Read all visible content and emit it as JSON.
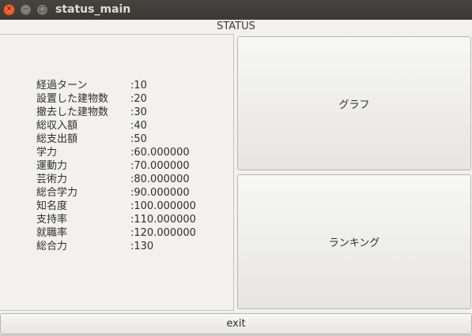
{
  "window": {
    "title": "status_main"
  },
  "header": {
    "label": "STATUS"
  },
  "stats": [
    {
      "label": "経過ターン",
      "value": ":10"
    },
    {
      "label": "設置した建物数",
      "value": ":20"
    },
    {
      "label": "撤去した建物数",
      "value": ":30"
    },
    {
      "label": "総収入額",
      "value": ":40"
    },
    {
      "label": "総支出額",
      "value": ":50"
    },
    {
      "label": "学力",
      "value": ":60.000000"
    },
    {
      "label": "運動力",
      "value": ":70.000000"
    },
    {
      "label": "芸術力",
      "value": ":80.000000"
    },
    {
      "label": "総合学力",
      "value": ":90.000000"
    },
    {
      "label": "知名度",
      "value": ":100.000000"
    },
    {
      "label": "支持率",
      "value": ":110.000000"
    },
    {
      "label": "就職率",
      "value": ":120.000000"
    },
    {
      "label": "総合力",
      "value": ":130"
    }
  ],
  "buttons": {
    "graph": "グラフ",
    "ranking": "ランキング",
    "exit": "exit"
  },
  "icons": {
    "close": "close-icon",
    "minimize": "minimize-icon",
    "maximize": "maximize-icon"
  },
  "colors": {
    "titlebar": "#3c3b37",
    "close": "#e8602c",
    "background": "#f2f1f0"
  }
}
